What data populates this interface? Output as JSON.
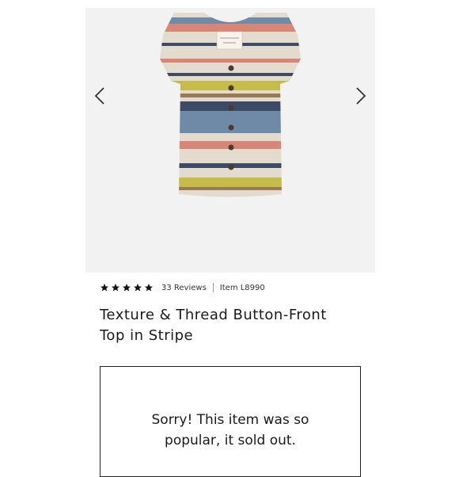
{
  "product": {
    "rating": 5,
    "reviews": "33 Reviews",
    "item": "Item L8990",
    "title": "Texture & Thread Button-Front Top in Stripe",
    "tag_text": "Texture & Thread"
  },
  "soldout": {
    "message": "Sorry! This item was so popular, it sold out."
  },
  "icons": {
    "prev": "chevron-left-icon",
    "next": "chevron-right-icon",
    "star": "star-icon"
  },
  "colors": {
    "fabric": "#e4dbcf",
    "stripe_red": "#d98677",
    "stripe_yellow": "#c6bc49",
    "stripe_blue": "#6f8aa6",
    "stripe_navy": "#3d4a66",
    "stripe_brown": "#9a7a52",
    "gallery_bg": "#f2f2f2"
  }
}
